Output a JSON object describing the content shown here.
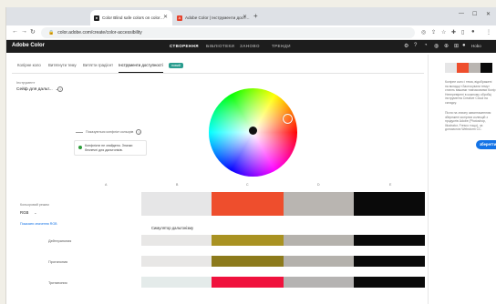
{
  "browser": {
    "tabs": [
      {
        "title": "Color Blind safe colors on color…",
        "active": true
      },
      {
        "title": "Adobe Color | Інструменти дост…",
        "active": false
      }
    ],
    "url": "color.adobe.com/create/color-accessibility",
    "profile_label": "Hobo"
  },
  "app": {
    "brand": "Adobe Color",
    "nav": [
      {
        "label": "СТВОРЕННЯ",
        "active": true
      },
      {
        "label": "БІБЛІОТЕКИ",
        "active": false
      },
      {
        "label": "ЗАНОВО",
        "active": false
      },
      {
        "label": "ТРЕНДИ",
        "active": false
      }
    ]
  },
  "subtabs": [
    {
      "label": "Колірне коло",
      "active": false
    },
    {
      "label": "Витягнути тему",
      "active": false
    },
    {
      "label": "Витягти градієнт",
      "active": false
    },
    {
      "label": "Інструменти доступності",
      "active": true
    }
  ],
  "new_badge": "новий",
  "tool": {
    "label": "Інструмент",
    "selected": "Сейф для дальт..."
  },
  "conflict": {
    "label": "Показуються конфлікт кольорів",
    "message": "Конфлікти не знайдено. Значки безпечні для дальтоніків."
  },
  "column_letters": [
    "A",
    "B",
    "C",
    "D",
    "E"
  ],
  "color_mode": {
    "label": "Кольоровий режим",
    "value": "RGB",
    "link": "Показати значення RGB"
  },
  "simulation_label": "Симулятор дальтонізму",
  "base_swatches": [
    "#e6e6e7",
    "#ee4e2d",
    "#b9b5b1",
    "#0a0a0a"
  ],
  "simulations": [
    {
      "label": "Дейтеранопия",
      "colors": [
        "#e8e7e6",
        "#a99222",
        "#b5b2ad",
        "#0a0a0a"
      ]
    },
    {
      "label": "Протанопия",
      "colors": [
        "#e8e7e6",
        "#8c7a1c",
        "#b4b1ac",
        "#0a0a0a"
      ]
    },
    {
      "label": "Тританопия",
      "colors": [
        "#e4ebea",
        "#f0123d",
        "#b5b3b2",
        "#0a0a0a"
      ]
    }
  ],
  "sidebar": {
    "mini_colors": [
      "#e6e6e7",
      "#ee4e2d",
      "#b9b5b1",
      "#0a0a0a"
    ],
    "text1": "Колірне коло і тема, відображені на вкладці «Застосувати тему» стають вашими тимчасовими Колір Неперевірені в кожному обробці інструмента Creative Cloud на складку.",
    "text2": "Після на значну завантаженням збережені колірних колекцій з продуктів Adobe (Photoshop, Illustrator, Fresco тощо), за допомогою Webstorm CC.",
    "button": "зберегти"
  },
  "colors": {
    "accent": "#1473e6",
    "badge": "#2a9d8f",
    "header_bg": "#1d1d1d"
  }
}
